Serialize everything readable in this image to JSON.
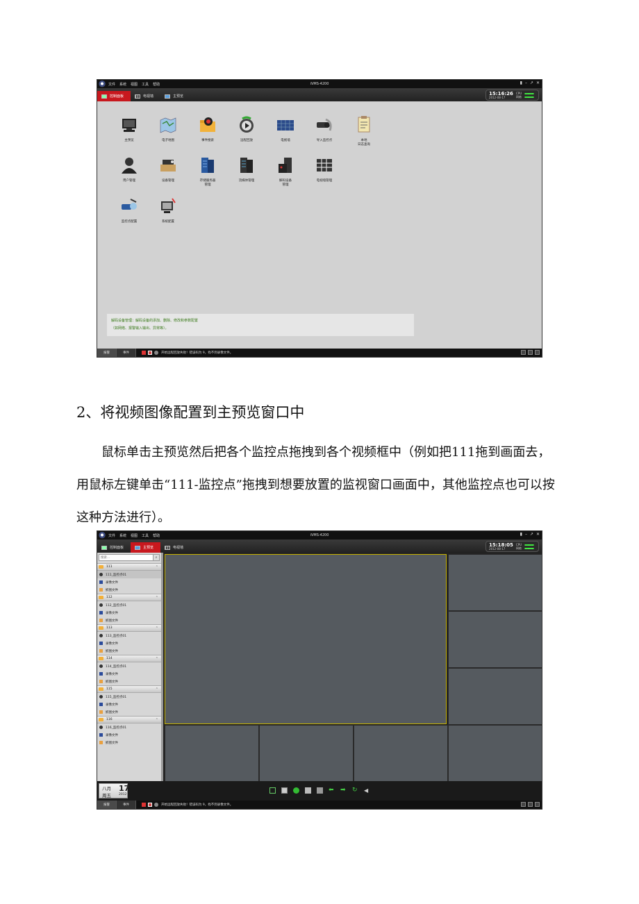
{
  "window1": {
    "app_title": "iVMS-4200",
    "menu": [
      "文件",
      "系统",
      "视图",
      "工具",
      "帮助"
    ],
    "tabs": [
      "控制面板",
      "电视墙",
      "主预览"
    ],
    "clock": {
      "time": "15:16:26",
      "date": "2012-08-17",
      "cpu_label": "CPU",
      "net_label": "网络"
    },
    "items": [
      {
        "label": "主预览",
        "icon": "monitor-icon"
      },
      {
        "label": "电子地图",
        "icon": "map-icon"
      },
      {
        "label": "事件搜索",
        "icon": "folder-search-icon"
      },
      {
        "label": "远程回放",
        "icon": "playback-icon"
      },
      {
        "label": "电视墙",
        "icon": "tv-wall-icon"
      },
      {
        "label": "导入监控点",
        "icon": "camera-import-icon"
      },
      {
        "label": "本地",
        "label2": "日志查询",
        "icon": "log-icon"
      },
      {
        "label": "用户管理",
        "icon": "user-icon"
      },
      {
        "label": "设备管理",
        "icon": "device-icon"
      },
      {
        "label": "存储服务器",
        "label2": "管理",
        "icon": "storage-server-icon"
      },
      {
        "label": "流媒体管理",
        "icon": "stream-server-icon"
      },
      {
        "label": "解码设备",
        "label2": "管理",
        "icon": "decoder-icon"
      },
      {
        "label": "电视墙管理",
        "icon": "tv-wall-manage-icon"
      },
      {
        "label": "监控点配置",
        "icon": "camera-config-icon"
      },
      {
        "label": "系统配置",
        "icon": "system-config-icon"
      }
    ],
    "hint_line1": "解码设备管理：解码设备的添加、删除、修改和参数配置",
    "hint_line2": "（如网络、报警输入输出、异常等）。",
    "status": {
      "tab1": "报警",
      "tab2": "事件",
      "message": "开始远程回放失败！错误码为 9，找不到录像文件。"
    }
  },
  "section": {
    "heading": "2、将视频图像配置到主预览窗口中",
    "paragraph": "鼠标单击主预览然后把各个监控点拖拽到各个视频框中（例如把111拖到画面去，用鼠标左键单击“111-监控点”拖拽到想要放置的监视窗口画面中，其他监控点也可以按这种方法进行）。"
  },
  "window2": {
    "app_title": "iVMS-4200",
    "menu": [
      "文件",
      "系统",
      "视图",
      "工具",
      "帮助"
    ],
    "tabs": [
      "控制面板",
      "主预览",
      "电视墙"
    ],
    "clock": {
      "time": "15:18:05",
      "date": "2012-08-17",
      "cpu_label": "CPU",
      "net_label": "网络"
    },
    "search_placeholder": "搜索...",
    "groups": [
      {
        "name": "111",
        "camera": "111_监控点01"
      },
      {
        "name": "112",
        "camera": "112_监控点01"
      },
      {
        "name": "113",
        "camera": "113_监控点01"
      },
      {
        "name": "114",
        "camera": "114_监控点01"
      },
      {
        "name": "115",
        "camera": "115_监控点01"
      },
      {
        "name": "116",
        "camera": "116_监控点01"
      }
    ],
    "record_label": "录像文件",
    "snapshot_label": "抓图文件",
    "calendar": {
      "month": "八月",
      "day": "17",
      "weekday": "周五",
      "year": "2012"
    },
    "status": {
      "tab1": "报警",
      "tab2": "事件",
      "message": "开始远程回放失败！错误码为 9，找不到录像文件。"
    }
  }
}
